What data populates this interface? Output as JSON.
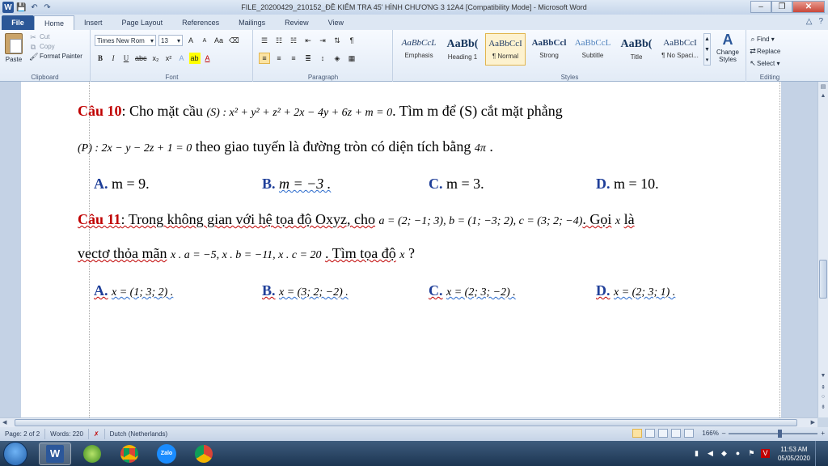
{
  "window": {
    "title": "FILE_20200429_210152_ĐỀ KIỂM TRA 45' HÌNH CHƯƠNG 3 12A4 [Compatibility Mode] - Microsoft Word",
    "app_logo": "W",
    "minimize": "–",
    "maximize": "❐",
    "close": "✕"
  },
  "qat": {
    "save": "💾",
    "undo": "↶",
    "redo": "↷"
  },
  "tabs": {
    "file": "File",
    "items": [
      "Home",
      "Insert",
      "Page Layout",
      "References",
      "Mailings",
      "Review",
      "View"
    ],
    "active": "Home",
    "minimize_ribbon": "△",
    "help": "?"
  },
  "ribbon": {
    "clipboard": {
      "label": "Clipboard",
      "paste": "Paste",
      "cut": "Cut",
      "copy": "Copy",
      "format_painter": "Format Painter"
    },
    "font": {
      "label": "Font",
      "font_name": "Times New Rom",
      "font_size": "13",
      "grow": "A",
      "shrink": "A",
      "case": "Aa",
      "clear": "⌫",
      "bold": "B",
      "italic": "I",
      "underline": "U",
      "strike": "abc",
      "subscript": "x₂",
      "superscript": "x²",
      "text_effects": "A",
      "highlight": "ab",
      "font_color": "A"
    },
    "paragraph": {
      "label": "Paragraph"
    },
    "styles": {
      "label": "Styles",
      "items": [
        {
          "sample": "AaBbCcL",
          "name": "Emphasis"
        },
        {
          "sample": "AaBb(",
          "name": "Heading 1"
        },
        {
          "sample": "AaBbCcI",
          "name": "¶ Normal"
        },
        {
          "sample": "AaBbCcl",
          "name": "Strong"
        },
        {
          "sample": "AaBbCcL",
          "name": "Subtitle"
        },
        {
          "sample": "AaBb(",
          "name": "Title"
        },
        {
          "sample": "AaBbCcI",
          "name": "¶ No Spaci..."
        }
      ],
      "active_index": 2,
      "change_styles": "Change Styles"
    },
    "editing": {
      "label": "Editing",
      "find": "Find",
      "replace": "Replace",
      "select": "Select"
    }
  },
  "document": {
    "q10": {
      "label": "Câu 10",
      "text1": ": Cho mặt cầu",
      "eq1": "(S) : x² + y² + z² + 2x − 4y + 6z + m = 0",
      "text2": ". Tìm m để (S) cắt mặt phẳng",
      "eq2": "(P) : 2x − y − 2z + 1 = 0",
      "text3": "theo giao tuyến là đường tròn có diện tích bằng",
      "eq3": "4π",
      "end": ".",
      "options": [
        {
          "letter": "A.",
          "text": "m = 9."
        },
        {
          "letter": "B.",
          "text": "m = −3 ."
        },
        {
          "letter": "C.",
          "text": "m = 3."
        },
        {
          "letter": "D.",
          "text": "m = 10."
        }
      ]
    },
    "q11": {
      "label": "Câu 11",
      "text1": ": Trong không gian với hệ tọa độ Oxyz, cho",
      "eq1": "a = (2; −1; 3), b = (1; −3; 2), c = (3; 2; −4)",
      "text2": ". Gọi",
      "eq2": "x",
      "text3": "là",
      "text4": "vectơ thỏa mãn",
      "eq3": "x . a = −5,  x . b = −11,  x . c = 20",
      "text5": ". Tìm tọa độ",
      "eq4": "x",
      "text6": "?",
      "options": [
        {
          "letter": "A.",
          "text": "x = (1; 3; 2) ."
        },
        {
          "letter": "B.",
          "text": "x = (3; 2; −2) ."
        },
        {
          "letter": "C.",
          "text": "x = (2; 3; −2) ."
        },
        {
          "letter": "D.",
          "text": "x = (2; 3; 1) ."
        }
      ]
    }
  },
  "status": {
    "page": "Page: 2 of 2",
    "words": "Words: 220",
    "language": "Dutch (Netherlands)",
    "zoom": "166%",
    "zoom_minus": "–",
    "zoom_plus": "+"
  },
  "taskbar": {
    "word": "W",
    "zalo": "Zalo",
    "time": "11:53 AM",
    "date": "05/05/2020"
  }
}
